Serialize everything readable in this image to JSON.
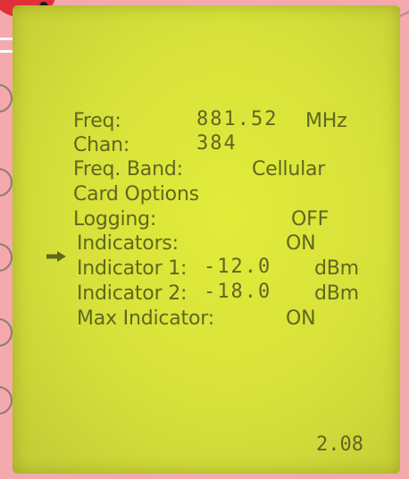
{
  "display": {
    "freq_label": "Freq:",
    "freq_value": "881.52",
    "freq_unit": "MHz",
    "chan_label": "Chan:",
    "chan_value": "384",
    "band_label": "Freq. Band:",
    "band_value": "Cellular",
    "card_options": "Card Options",
    "logging_label": "Logging:",
    "logging_value": "OFF",
    "indicators_label": "Indicators:",
    "indicators_value": "ON",
    "ind1_label": "Indicator 1:",
    "ind1_value": "-12.0",
    "ind1_unit": "dBm",
    "ind2_label": "Indicator 2:",
    "ind2_value": "-18.0",
    "ind2_unit": "dBm",
    "max_label": "Max Indicator:",
    "max_value": "ON",
    "version": "2.08"
  },
  "colors": {
    "lcd_background": "#d9e23a",
    "lcd_text": "#5f6720",
    "device_body": "#f4a9ad"
  },
  "icons": {
    "selection_cursor": "right-arrow-icon"
  }
}
